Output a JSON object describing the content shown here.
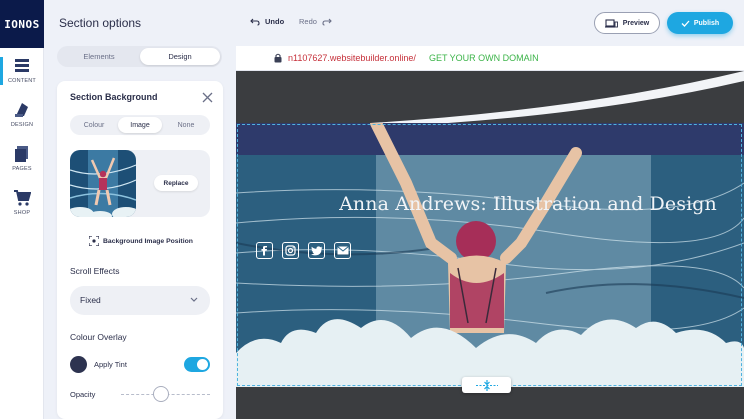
{
  "brand": {
    "logo_text": "IONOS"
  },
  "rail": {
    "items": [
      {
        "label": "CONTENT",
        "icon": "content-icon",
        "active": true
      },
      {
        "label": "DESIGN",
        "icon": "design-icon",
        "active": false
      },
      {
        "label": "PAGES",
        "icon": "pages-icon",
        "active": false
      },
      {
        "label": "SHOP",
        "icon": "shop-icon",
        "active": false
      }
    ]
  },
  "panel": {
    "title": "Section options",
    "tabs": [
      {
        "label": "Elements",
        "active": false
      },
      {
        "label": "Design",
        "active": true
      }
    ],
    "section_background": {
      "title": "Section Background",
      "options": [
        {
          "label": "Colour",
          "active": false
        },
        {
          "label": "Image",
          "active": true
        },
        {
          "label": "None",
          "active": false
        }
      ],
      "replace_label": "Replace",
      "position_label": "Background Image Position"
    },
    "scroll_effects": {
      "label": "Scroll Effects",
      "value": "Fixed"
    },
    "colour_overlay": {
      "label": "Colour Overlay",
      "tint_label": "Apply Tint",
      "tint_color": "#2d3350",
      "tint_on": true,
      "opacity_label": "Opacity",
      "opacity_value": 0.45
    }
  },
  "toolbar": {
    "undo_label": "Undo",
    "redo_label": "Redo",
    "preview_label": "Preview",
    "publish_label": "Publish"
  },
  "browser": {
    "url": "n1107627.websitebuilder.online/",
    "domain_cta": "GET YOUR OWN DOMAIN"
  },
  "site": {
    "hero_title": "Anna Andrews: Illustration and Design",
    "socials": [
      "facebook-icon",
      "instagram-icon",
      "twitter-icon",
      "email-icon"
    ]
  },
  "colors": {
    "accent": "#1ea7e1",
    "navy": "#0b1a4a",
    "url_red": "#c6303a",
    "cta_green": "#3cb449"
  }
}
